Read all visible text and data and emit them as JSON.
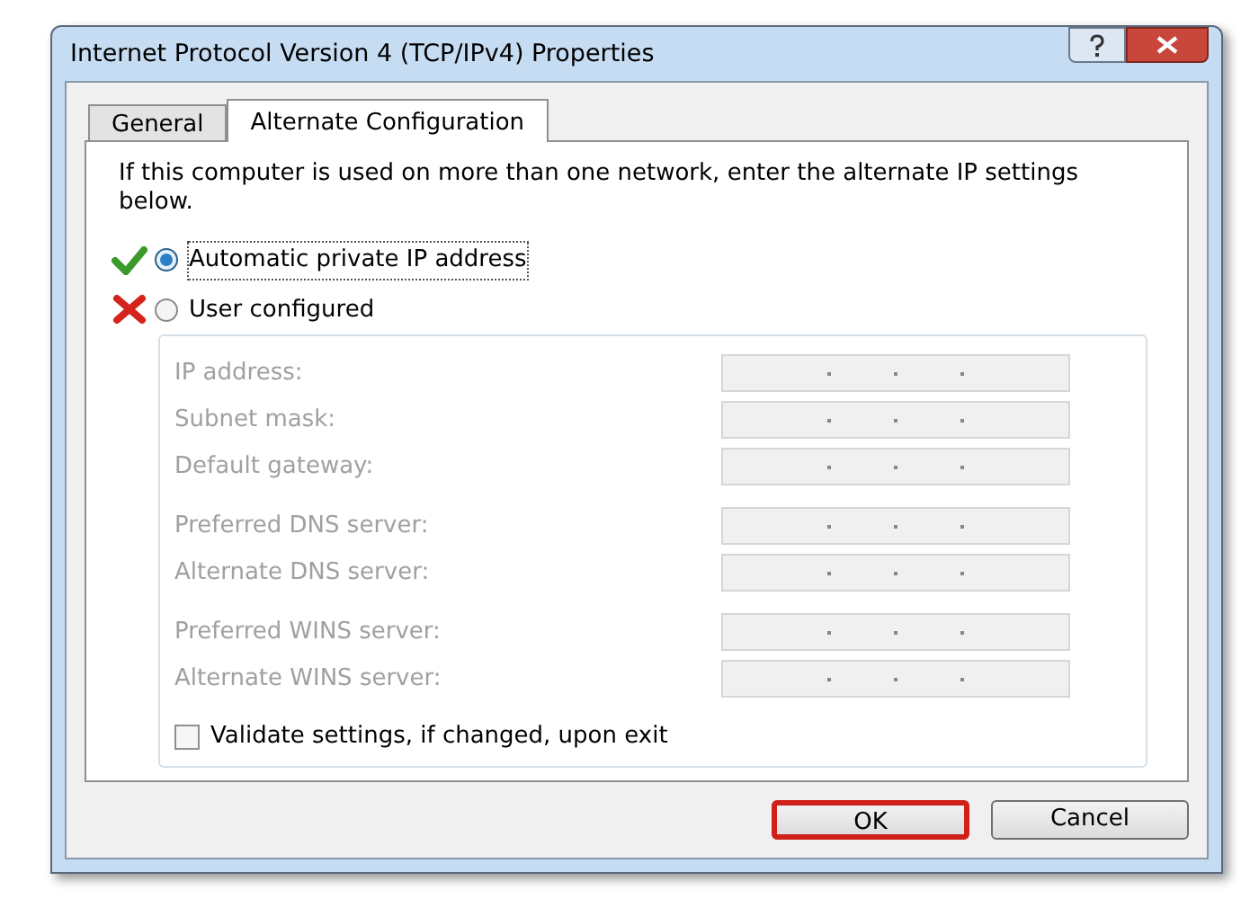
{
  "window": {
    "title": "Internet Protocol Version 4 (TCP/IPv4) Properties"
  },
  "tabs": [
    {
      "label": "General",
      "selected": false
    },
    {
      "label": "Alternate Configuration",
      "selected": true
    }
  ],
  "intro": "If this computer is used on more than one network, enter the alternate IP settings below.",
  "options": [
    {
      "label": "Automatic private IP address",
      "selected": true,
      "kind": "check"
    },
    {
      "label": "User configured",
      "selected": false,
      "kind": "cross"
    }
  ],
  "field_groups": [
    {
      "fields": [
        {
          "label": "IP address:",
          "disabled": true
        },
        {
          "label": "Subnet mask:",
          "disabled": true
        },
        {
          "label": "Default gateway:",
          "disabled": true
        }
      ]
    },
    {
      "fields": [
        {
          "label": "Preferred DNS server:",
          "disabled": true
        },
        {
          "label": "Alternate DNS server:",
          "disabled": true
        }
      ]
    },
    {
      "fields": [
        {
          "label": "Preferred WINS server:",
          "disabled": true
        },
        {
          "label": "Alternate WINS server:",
          "disabled": true
        }
      ]
    }
  ],
  "validate": {
    "label": "Validate settings, if changed, upon exit",
    "checked": false
  },
  "buttons": [
    {
      "label": "OK",
      "highlighted": true
    },
    {
      "label": "Cancel",
      "highlighted": false
    }
  ]
}
